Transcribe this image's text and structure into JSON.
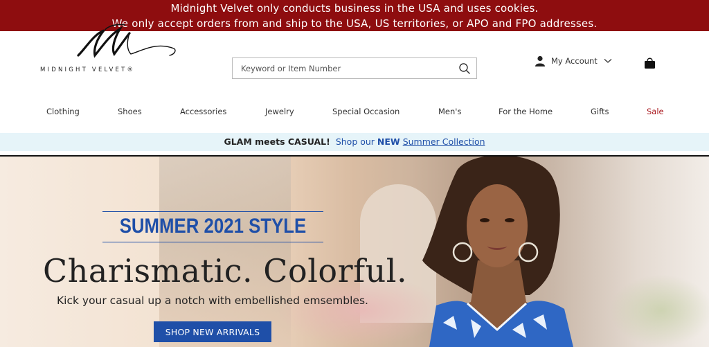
{
  "notice": {
    "line1": "Midnight Velvet only conducts business in the USA and uses cookies.",
    "line2": "We only accept orders from and ship to the USA, US territories, or APO and FPO addresses."
  },
  "header": {
    "logo_text": "MIDNIGHT VELVET®",
    "search_placeholder": "Keyword or Item Number",
    "account_label": "My Account"
  },
  "nav": {
    "items": [
      "Clothing",
      "Shoes",
      "Accessories",
      "Jewelry",
      "Special Occasion",
      "Men's",
      "For the Home",
      "Gifts",
      "Sale"
    ]
  },
  "promo": {
    "bold": "GLAM meets CASUAL!",
    "shop": "Shop our",
    "new": "NEW",
    "link": "Summer Collection"
  },
  "hero": {
    "tag": "SUMMER 2021 STYLE",
    "headline": "Charismatic. Colorful.",
    "subtext": "Kick your casual up a notch with embellished emsembles.",
    "cta": "SHOP NEW ARRIVALS"
  },
  "colors": {
    "notice_bg": "#8e0d0f",
    "brand_blue": "#1f4fa8",
    "sale_red": "#a8141a",
    "promo_bg": "#e6f4f9"
  },
  "icons": [
    "search-icon",
    "person-icon",
    "chevron-down-icon",
    "shopping-bag-icon"
  ]
}
